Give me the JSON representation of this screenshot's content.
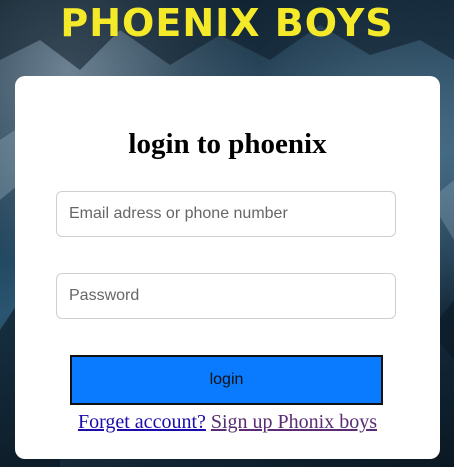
{
  "header": {
    "brand": "PHOENIX BOYS"
  },
  "login_card": {
    "title": "login to phoenix",
    "email_placeholder": "Email adress or phone number",
    "email_value": "",
    "password_placeholder": "Password",
    "password_value": "",
    "login_label": "login",
    "forget_link": "Forget account?",
    "signup_link": "Sign up Phonix boys"
  },
  "colors": {
    "brand_text": "#f5ea2a",
    "button_bg": "#0a7bff",
    "card_bg": "#ffffff"
  }
}
